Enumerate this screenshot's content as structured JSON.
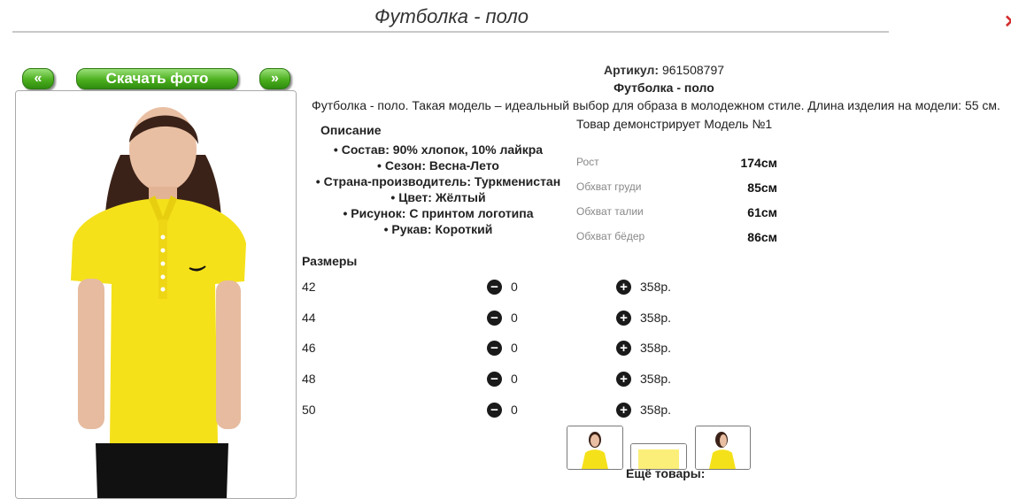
{
  "page": {
    "title": "Футболка - поло",
    "close_icon": "close-icon"
  },
  "gallery": {
    "prev_label": "«",
    "download_label": "Скачать фото",
    "next_label": "»"
  },
  "product": {
    "article_label": "Артикул:",
    "article_value": "961508797",
    "name": "Футболка - поло",
    "description": "Футболка - поло. Такая модель – идеальный выбор для образа в молодежном стиле. Длина изделия на модели: 55 см."
  },
  "details": {
    "title": "Описание",
    "items": [
      "Состав: 90% хлопок, 10% лайкра",
      "Сезон: Весна-Лето",
      "Страна-производитель: Туркменистан",
      "Цвет: Жёлтый",
      "Рисунок: С принтом логотипа",
      "Рукав: Короткий"
    ]
  },
  "model": {
    "demo_text": "Товар демонстрирует Модель №1",
    "measurements": [
      {
        "label": "Рост",
        "value": "174см"
      },
      {
        "label": "Обхват груди",
        "value": "85см"
      },
      {
        "label": "Обхват талии",
        "value": "61см"
      },
      {
        "label": "Обхват бёдер",
        "value": "86см"
      }
    ]
  },
  "sizes": {
    "title": "Размеры",
    "rows": [
      {
        "size": "42",
        "qty": "0",
        "price": "358р."
      },
      {
        "size": "44",
        "qty": "0",
        "price": "358р."
      },
      {
        "size": "46",
        "qty": "0",
        "price": "358р."
      },
      {
        "size": "48",
        "qty": "0",
        "price": "358р."
      },
      {
        "size": "50",
        "qty": "0",
        "price": "358р."
      }
    ]
  },
  "more": {
    "label": "Ещё товары:"
  },
  "colors": {
    "accent_green": "#4caf1f",
    "shirt_yellow": "#f5e11a",
    "close_red": "#d32f2f"
  }
}
